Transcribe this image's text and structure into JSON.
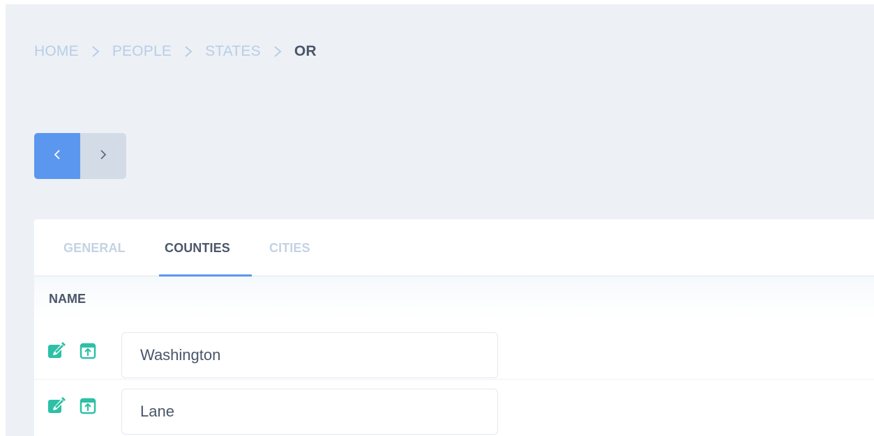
{
  "breadcrumb": {
    "items": [
      "HOME",
      "PEOPLE",
      "STATES"
    ],
    "current": "OR"
  },
  "pager": {
    "prev_icon": "chevron-left-icon",
    "next_icon": "chevron-right-icon",
    "prev_color": "#5b97ee",
    "next_color": "#d3dce6"
  },
  "tabs": [
    {
      "label": "GENERAL",
      "active": false
    },
    {
      "label": "COUNTIES",
      "active": true
    },
    {
      "label": "CITIES",
      "active": false
    }
  ],
  "table": {
    "columns": [
      "NAME"
    ],
    "rows": [
      {
        "name": "Washington",
        "icons": [
          "edit-icon",
          "open-external-icon"
        ]
      },
      {
        "name": "Lane",
        "icons": [
          "edit-icon",
          "open-external-icon"
        ]
      }
    ]
  },
  "colors": {
    "accent": "#5b97ee",
    "icon": "#2cc0a6",
    "text_dark": "#4a5668",
    "text_muted": "#b8cde6",
    "background": "#edf1f6"
  }
}
